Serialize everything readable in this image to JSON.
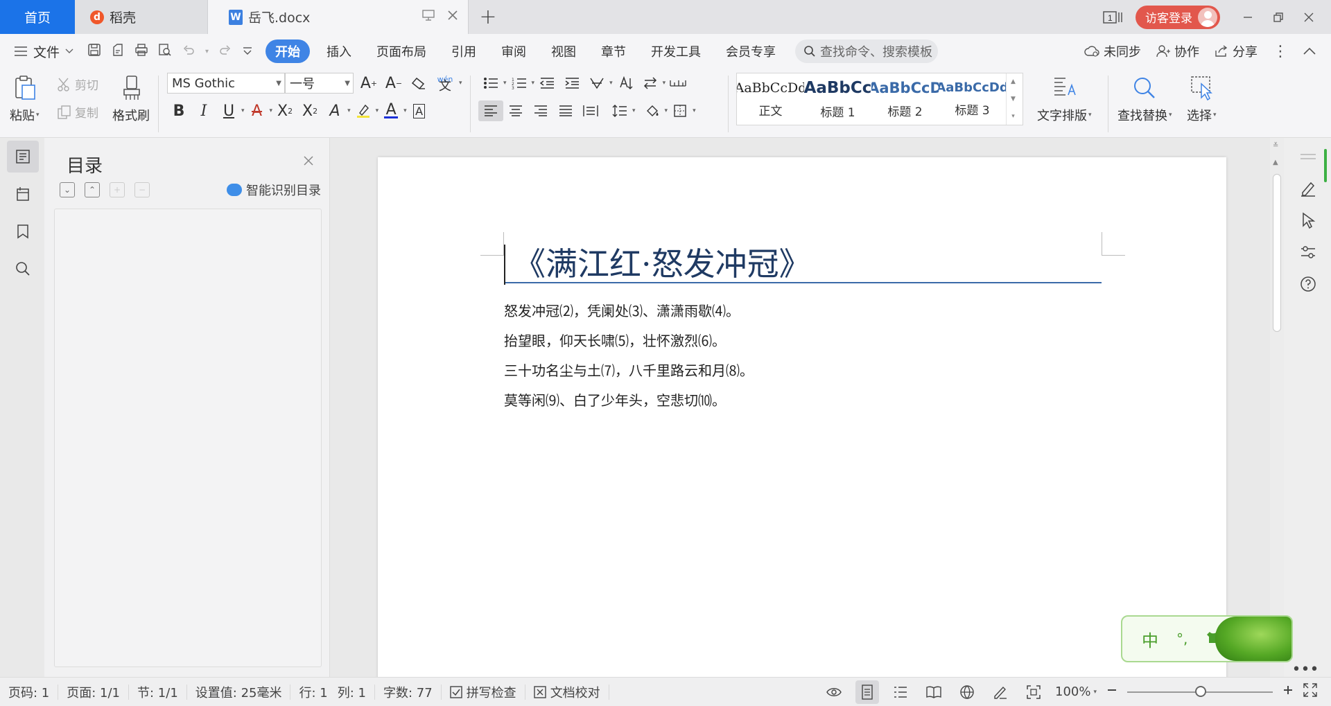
{
  "tabs": {
    "home": "首页",
    "daoke": "稻壳",
    "doc": "岳飞.docx",
    "add": "+"
  },
  "titlebar": {
    "page_indicator": "1",
    "login": "访客登录"
  },
  "menu": {
    "file": "文件",
    "tabs": [
      "开始",
      "插入",
      "页面布局",
      "引用",
      "审阅",
      "视图",
      "章节",
      "开发工具",
      "会员专享"
    ],
    "search_placeholder": "查找命令、搜索模板",
    "sync": "未同步",
    "collab": "协作",
    "share": "分享"
  },
  "ribbon": {
    "paste": "粘贴",
    "cut": "剪切",
    "copy": "复制",
    "format_painter": "格式刷",
    "font_name": "MS Gothic",
    "font_size": "一号",
    "phonetic": "wén",
    "styles": [
      {
        "sample": "AaBbCcDd",
        "name": "正文",
        "color": "#222222",
        "bold": false
      },
      {
        "sample": "AaBbCc",
        "name": "标题 1",
        "color": "#1f3a63",
        "bold": true
      },
      {
        "sample": "AaBbCcD",
        "name": "标题 2",
        "color": "#3a6aa8",
        "bold": true
      },
      {
        "sample": "AaBbCcDd",
        "name": "标题 3",
        "color": "#3a6aa8",
        "bold": true
      }
    ],
    "text_layout": "文字排版",
    "find_replace": "查找替换",
    "select": "选择"
  },
  "toc": {
    "title": "目录",
    "smart": "智能识别目录"
  },
  "document": {
    "title": "《满江红·怒发冲冠》",
    "lines": [
      "怒发冲冠⑵，凭阑处⑶、潇潇雨歇⑷。",
      "抬望眼，仰天长啸⑸，壮怀激烈⑹。",
      "三十功名尘与土⑺，八千里路云和月⑻。",
      "莫等闲⑼、白了少年头，空悲切⑽。"
    ]
  },
  "ime": {
    "lang": "中",
    "punct": "°,"
  },
  "status": {
    "page": "页码: 1",
    "pages": "页面: 1/1",
    "section": "节: 1/1",
    "setting": "设置值: 25毫米",
    "row": "行: 1",
    "col": "列: 1",
    "words": "字数: 77",
    "spell": "拼写检查",
    "proof": "文档校对",
    "zoom": "100%",
    "zoom_level": 1.0
  },
  "colors": {
    "accent": "#1b73e8",
    "ribbon_active": "#3f84e5",
    "login": "#e2574c",
    "title_text": "#1f3a63",
    "title_rule": "#3a6aa8"
  }
}
